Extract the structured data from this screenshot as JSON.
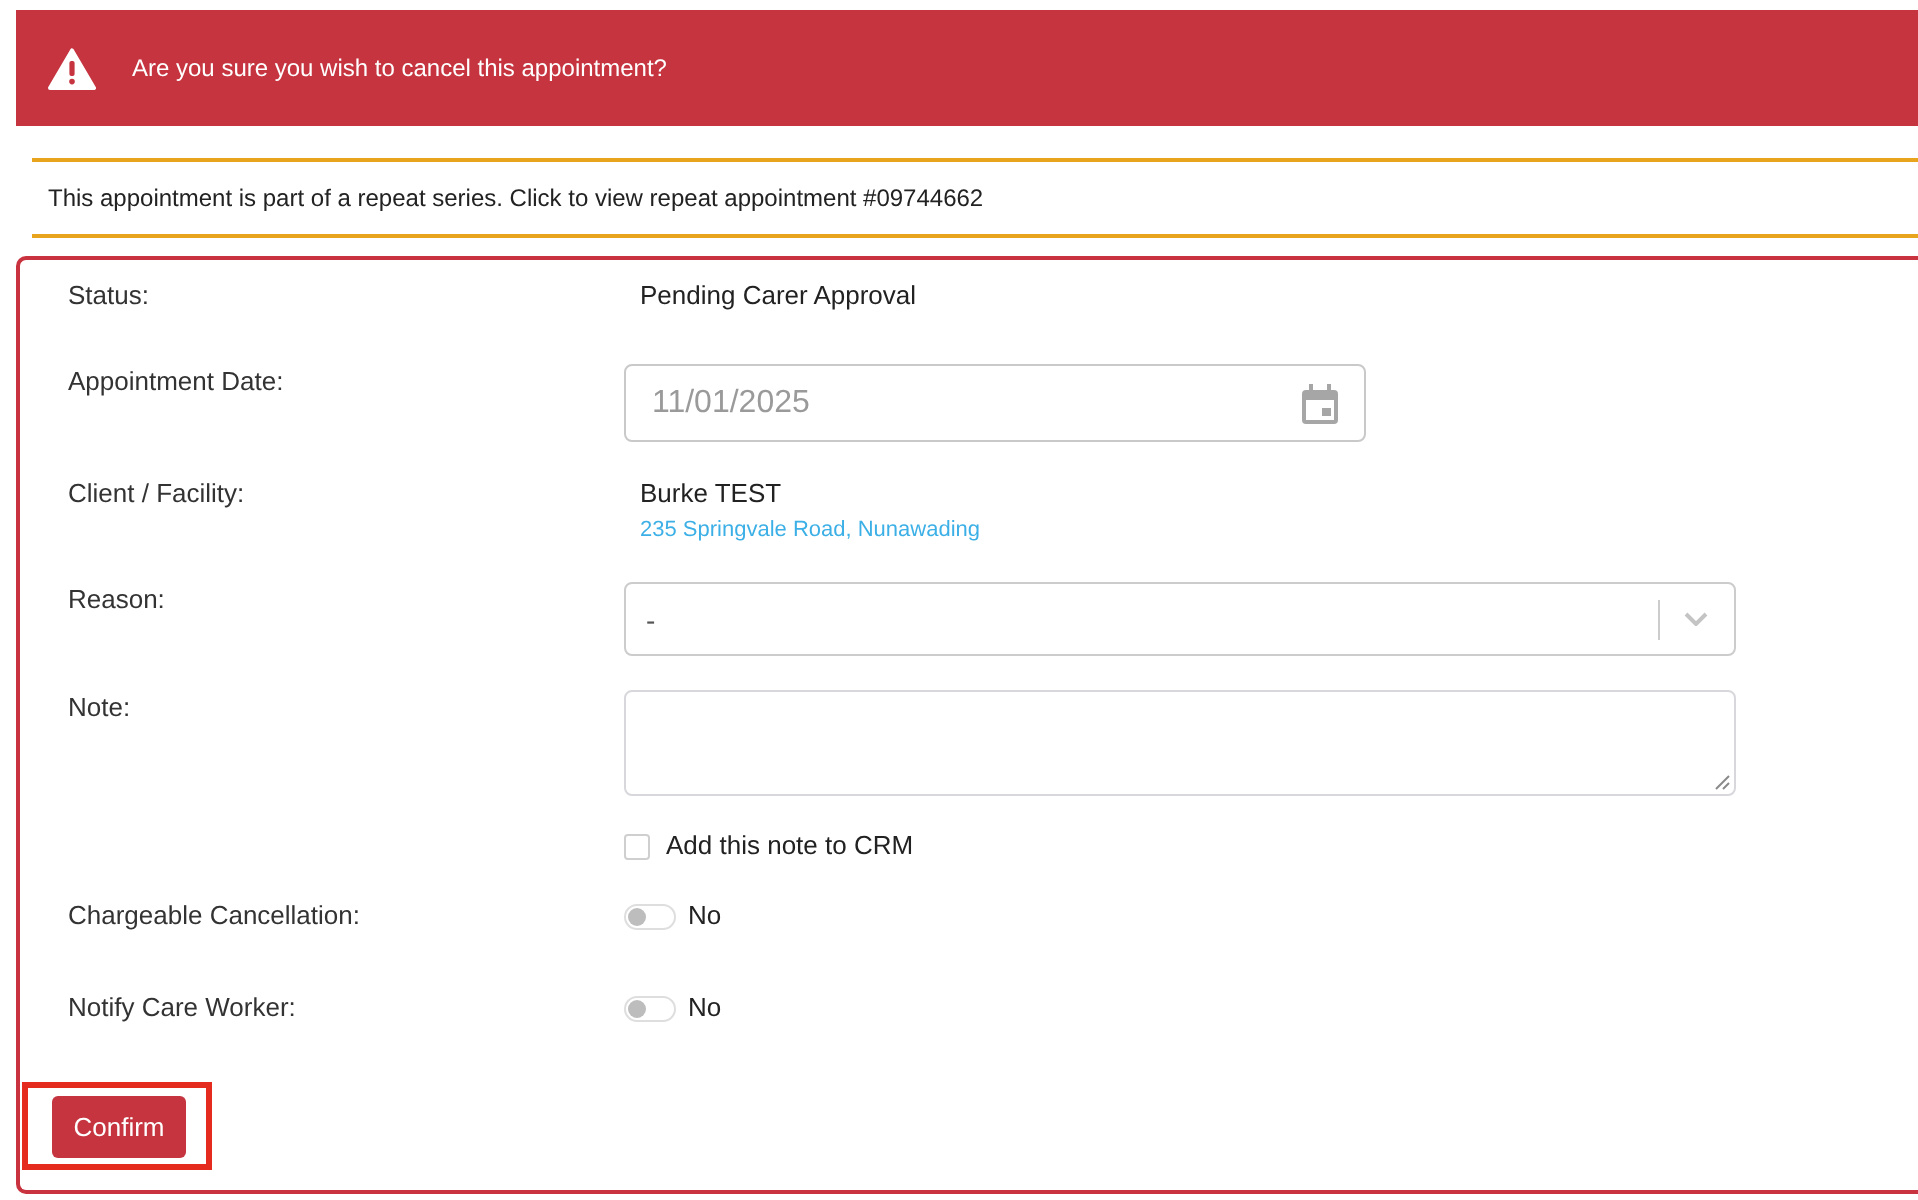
{
  "alert": {
    "message": "Are you sure you wish to cancel this appointment?"
  },
  "notice": {
    "text": "This appointment is part of a repeat series. Click to view repeat appointment #09744662"
  },
  "form": {
    "fields": [
      {
        "kind": "text",
        "label": "Status:",
        "value": "Pending Carer Approval"
      },
      {
        "kind": "date",
        "label": "Appointment Date:",
        "value": "11/01/2025",
        "disabled": true
      },
      {
        "kind": "client",
        "label": "Client / Facility:",
        "value": "Burke TEST",
        "address": "235 Springvale Road, Nunawading"
      },
      {
        "kind": "select",
        "label": "Reason:",
        "value": "-"
      },
      {
        "kind": "textarea",
        "label": "Note:"
      },
      {
        "kind": "checkbox",
        "label": "Add this note to CRM",
        "checked": false
      },
      {
        "kind": "toggle",
        "label": "Chargeable Cancellation:",
        "on": false,
        "value": "No"
      },
      {
        "kind": "toggle",
        "label": "Notify Care Worker:",
        "on": false,
        "value": "No"
      }
    ],
    "confirm_button": {
      "label": "Confirm",
      "highlighted": true
    }
  }
}
